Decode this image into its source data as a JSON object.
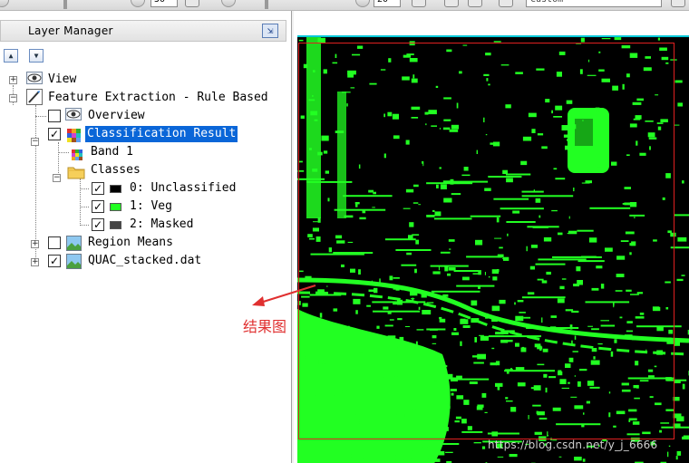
{
  "toolbar": {
    "value_a": "50",
    "value_b": "20",
    "stretch_dropdown": "Custom"
  },
  "layer_manager": {
    "title": "Layer Manager",
    "tree": {
      "view": "View",
      "feature_extraction": "Feature Extraction - Rule Based",
      "overview": "Overview",
      "classification_result": "Classification Result",
      "band": "Band 1",
      "classes": "Classes",
      "class_items": [
        {
          "label": "0: Unclassified",
          "color": "#000000",
          "checked": true
        },
        {
          "label": "1: Veg",
          "color": "#22ff22",
          "checked": true
        },
        {
          "label": "2: Masked",
          "color": "#444444",
          "checked": true
        }
      ],
      "region_means": "Region Means",
      "quac": "QUAC_stacked.dat"
    }
  },
  "annotation": {
    "text": "结果图",
    "color": "#e03030"
  },
  "watermark": "https://blog.csdn.net/y_j_6666",
  "colors": {
    "selection": "#0a66d8",
    "veg": "#22ff22",
    "unclassified": "#000000"
  }
}
